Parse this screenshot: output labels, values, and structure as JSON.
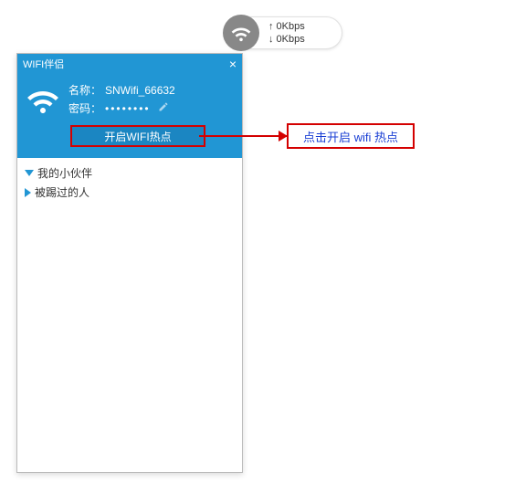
{
  "speed": {
    "up": "0Kbps",
    "down": "0Kbps"
  },
  "window": {
    "title": "WIFI伴侣"
  },
  "header": {
    "name_label": "名称：",
    "name_value": "SNWifi_66632",
    "password_label": "密码：",
    "password_masked": "••••••••",
    "open_button": "开启WIFI热点"
  },
  "list": {
    "item1": "我的小伙伴",
    "item2": "被踢过的人"
  },
  "annotation": {
    "text": "点击开启 wifi 热点"
  }
}
